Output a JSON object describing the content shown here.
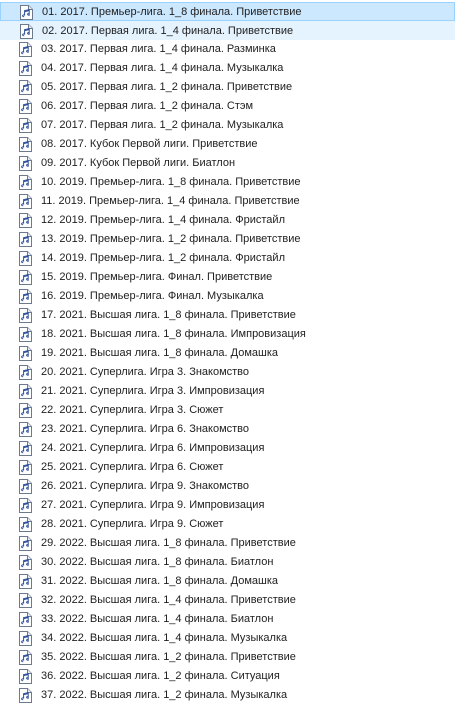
{
  "files": [
    {
      "name": "01. 2017. Премьер-лига. 1_8 финала. Приветствие",
      "state": "selected",
      "icon": "audio-file-icon"
    },
    {
      "name": "02. 2017. Первая лига. 1_4 финала. Приветствие",
      "state": "hover",
      "icon": "audio-file-icon"
    },
    {
      "name": "03. 2017. Первая лига. 1_4 финала. Разминка",
      "state": "normal",
      "icon": "audio-file-icon"
    },
    {
      "name": "04. 2017. Первая лига. 1_4 финала. Музыкалка",
      "state": "normal",
      "icon": "audio-file-icon"
    },
    {
      "name": "05. 2017. Первая лига. 1_2 финала. Приветствие",
      "state": "normal",
      "icon": "audio-file-icon"
    },
    {
      "name": "06. 2017. Первая лига. 1_2 финала. Стэм",
      "state": "normal",
      "icon": "audio-file-icon"
    },
    {
      "name": "07. 2017. Первая лига. 1_2 финала. Музыкалка",
      "state": "normal",
      "icon": "audio-file-icon"
    },
    {
      "name": "08. 2017. Кубок Первой лиги. Приветствие",
      "state": "normal",
      "icon": "audio-file-icon"
    },
    {
      "name": "09. 2017. Кубок Первой лиги. Биатлон",
      "state": "normal",
      "icon": "audio-file-icon"
    },
    {
      "name": "10. 2019. Премьер-лига. 1_8 финала. Приветствие",
      "state": "normal",
      "icon": "audio-file-icon"
    },
    {
      "name": "11. 2019. Премьер-лига. 1_4 финала. Приветствие",
      "state": "normal",
      "icon": "audio-file-icon"
    },
    {
      "name": "12. 2019. Премьер-лига. 1_4 финала. Фристайл",
      "state": "normal",
      "icon": "audio-file-icon"
    },
    {
      "name": "13. 2019. Премьер-лига. 1_2 финала. Приветствие",
      "state": "normal",
      "icon": "audio-file-icon"
    },
    {
      "name": "14. 2019. Премьер-лига. 1_2 финала. Фристайл",
      "state": "normal",
      "icon": "audio-file-icon"
    },
    {
      "name": "15. 2019. Премьер-лига. Финал. Приветствие",
      "state": "normal",
      "icon": "audio-file-icon"
    },
    {
      "name": "16. 2019. Премьер-лига. Финал. Музыкалка",
      "state": "normal",
      "icon": "audio-file-icon"
    },
    {
      "name": "17. 2021. Высшая лига. 1_8 финала. Приветствие",
      "state": "normal",
      "icon": "audio-file-icon"
    },
    {
      "name": "18. 2021. Высшая лига. 1_8 финала. Импровизация",
      "state": "normal",
      "icon": "audio-file-icon"
    },
    {
      "name": "19. 2021. Высшая лига. 1_8 финала. Домашка",
      "state": "normal",
      "icon": "audio-file-icon"
    },
    {
      "name": "20. 2021. Суперлига. Игра 3. Знакомство",
      "state": "normal",
      "icon": "audio-file-icon"
    },
    {
      "name": "21. 2021. Суперлига. Игра 3. Импровизация",
      "state": "normal",
      "icon": "audio-file-icon"
    },
    {
      "name": "22. 2021. Суперлига. Игра 3. Сюжет",
      "state": "normal",
      "icon": "audio-file-icon"
    },
    {
      "name": "23. 2021. Суперлига. Игра 6. Знакомство",
      "state": "normal",
      "icon": "audio-file-icon"
    },
    {
      "name": "24. 2021. Суперлига. Игра 6. Импровизация",
      "state": "normal",
      "icon": "audio-file-icon"
    },
    {
      "name": "25. 2021. Суперлига. Игра 6. Сюжет",
      "state": "normal",
      "icon": "audio-file-icon"
    },
    {
      "name": "26. 2021. Суперлига. Игра 9. Знакомство",
      "state": "normal",
      "icon": "audio-file-icon"
    },
    {
      "name": "27. 2021. Суперлига. Игра 9. Импровизация",
      "state": "normal",
      "icon": "audio-file-icon"
    },
    {
      "name": "28. 2021. Суперлига. Игра 9. Сюжет",
      "state": "normal",
      "icon": "audio-file-icon"
    },
    {
      "name": "29. 2022. Высшая лига. 1_8 финала. Приветствие",
      "state": "normal",
      "icon": "audio-file-icon"
    },
    {
      "name": "30. 2022. Высшая лига. 1_8 финала. Биатлон",
      "state": "normal",
      "icon": "audio-file-icon"
    },
    {
      "name": "31. 2022. Высшая лига. 1_8 финала. Домашка",
      "state": "normal",
      "icon": "audio-file-icon"
    },
    {
      "name": "32. 2022. Высшая лига. 1_4 финала. Приветствие",
      "state": "normal",
      "icon": "audio-file-icon"
    },
    {
      "name": "33. 2022. Высшая лига. 1_4 финала. Биатлон",
      "state": "normal",
      "icon": "audio-file-icon"
    },
    {
      "name": "34. 2022. Высшая лига. 1_4 финала. Музыкалка",
      "state": "normal",
      "icon": "audio-file-icon"
    },
    {
      "name": "35. 2022. Высшая лига. 1_2 финала. Приветствие",
      "state": "normal",
      "icon": "audio-file-icon"
    },
    {
      "name": "36. 2022. Высшая лига. 1_2 финала. Ситуация",
      "state": "normal",
      "icon": "audio-file-icon"
    },
    {
      "name": "37. 2022. Высшая лига. 1_2 финала. Музыкалка",
      "state": "normal",
      "icon": "audio-file-icon"
    }
  ],
  "colors": {
    "selected_bg": "#cce8ff",
    "selected_border": "#99d1ff",
    "hover_bg": "#e5f3ff",
    "text": "#1e1e1e",
    "icon_stroke": "#2b4f99"
  }
}
